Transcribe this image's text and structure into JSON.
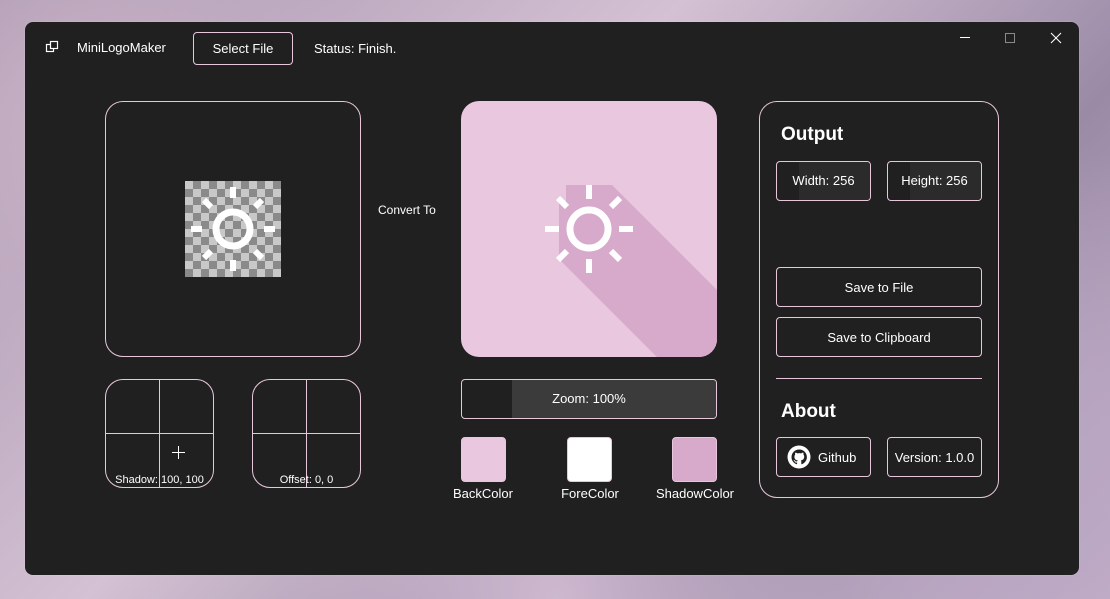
{
  "app": {
    "title": "MiniLogoMaker",
    "status": "Status: Finish."
  },
  "toolbar": {
    "select_file": "Select File"
  },
  "window_controls": {
    "minimize": "—",
    "maximize": "☐",
    "close": "✕"
  },
  "convert_label": "Convert To",
  "shadow_pad": {
    "label": "Shadow: 100, 100"
  },
  "offset_pad": {
    "label": "Offset: 0, 0"
  },
  "zoom": {
    "label": "Zoom: 100%",
    "value": 100
  },
  "colors": {
    "back": {
      "label": "BackColor",
      "hex": "#e8c7df"
    },
    "fore": {
      "label": "ForeColor",
      "hex": "#ffffff"
    },
    "shadow": {
      "label": "ShadowColor",
      "hex": "#d7a9cb"
    },
    "accent": "#e8c7dc"
  },
  "output": {
    "heading": "Output",
    "width": "Width: 256",
    "height": "Height: 256",
    "save_file": "Save to File",
    "save_clipboard": "Save to Clipboard"
  },
  "about": {
    "heading": "About",
    "github": "Github",
    "version": "Version: 1.0.0"
  }
}
